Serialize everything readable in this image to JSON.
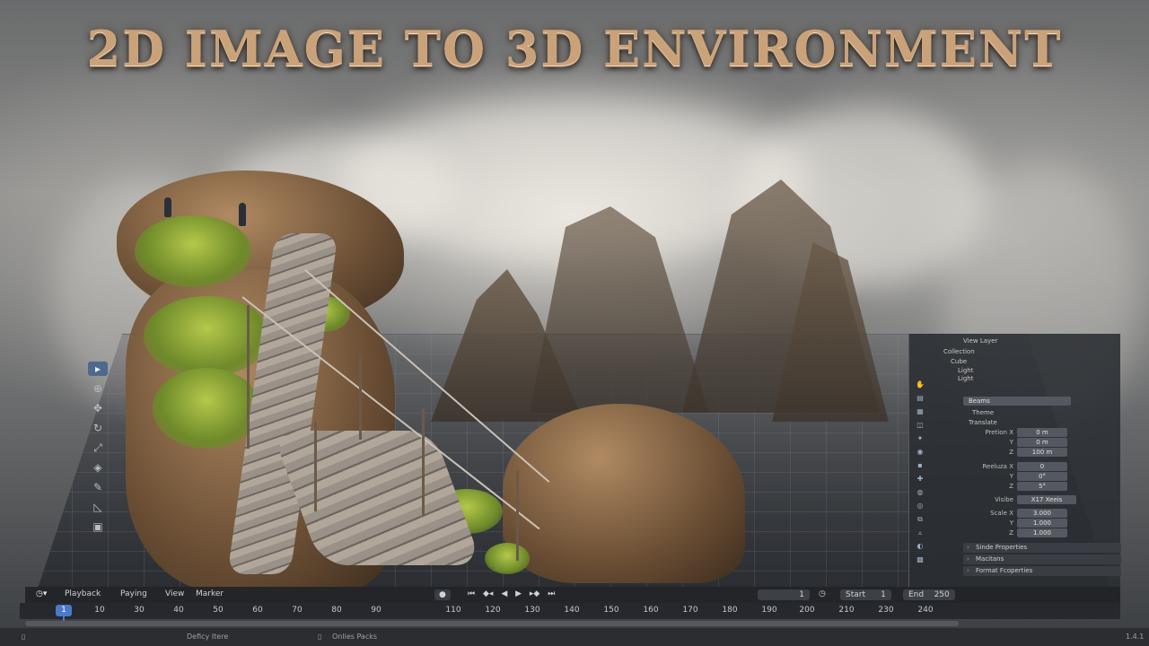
{
  "title": "2D IMAGE TO 3D ENVIRONMENT",
  "timeline": {
    "editor_icon": "clock-icon",
    "menus": [
      "Playback",
      "Paying",
      "View",
      "Marker"
    ],
    "record_icon": "●",
    "transport": [
      "⏮",
      "◆◂",
      "◀",
      "▶",
      "▸◆",
      "⏭"
    ],
    "current_frame": "1",
    "start_label": "Start",
    "start_value": "1",
    "end_label": "End",
    "end_value": "250",
    "playhead": "1",
    "ticks": [
      "10",
      "30",
      "40",
      "50",
      "60",
      "70",
      "80",
      "90",
      "110",
      "120",
      "130",
      "140",
      "150",
      "160",
      "170",
      "180",
      "190",
      "200",
      "210",
      "230",
      "240"
    ]
  },
  "status_bar": {
    "left_item": "Deficy Itere",
    "middle_item": "Onlies Packs",
    "version": "1.4.1"
  },
  "properties": {
    "header": "View Layer",
    "outliner": [
      "Collection",
      "Cube",
      "Light",
      "Light"
    ],
    "object_name": "Beams",
    "tab": "Theme",
    "section_transform": "Translate",
    "fields": [
      {
        "label": "Pretion X",
        "value": "0 m"
      },
      {
        "label": "Y",
        "value": "0 m"
      },
      {
        "label": "Z",
        "value": "100 m"
      },
      {
        "label": "Reeluza X",
        "value": "0"
      },
      {
        "label": "Y",
        "value": "0°"
      },
      {
        "label": "Z",
        "value": "5°"
      },
      {
        "label": "Visibe",
        "value": "X17 Xeeis"
      },
      {
        "label": "Scale X",
        "value": "3.000"
      },
      {
        "label": "Y",
        "value": "1.000"
      },
      {
        "label": "Z",
        "value": "1.000"
      }
    ],
    "sections": [
      "Sinde Properties",
      "Macitans",
      "Format Fcoperties"
    ]
  },
  "colors": {
    "accent": "#4b7bc8",
    "title": "#caa27a",
    "panel": "#2a2d32"
  }
}
